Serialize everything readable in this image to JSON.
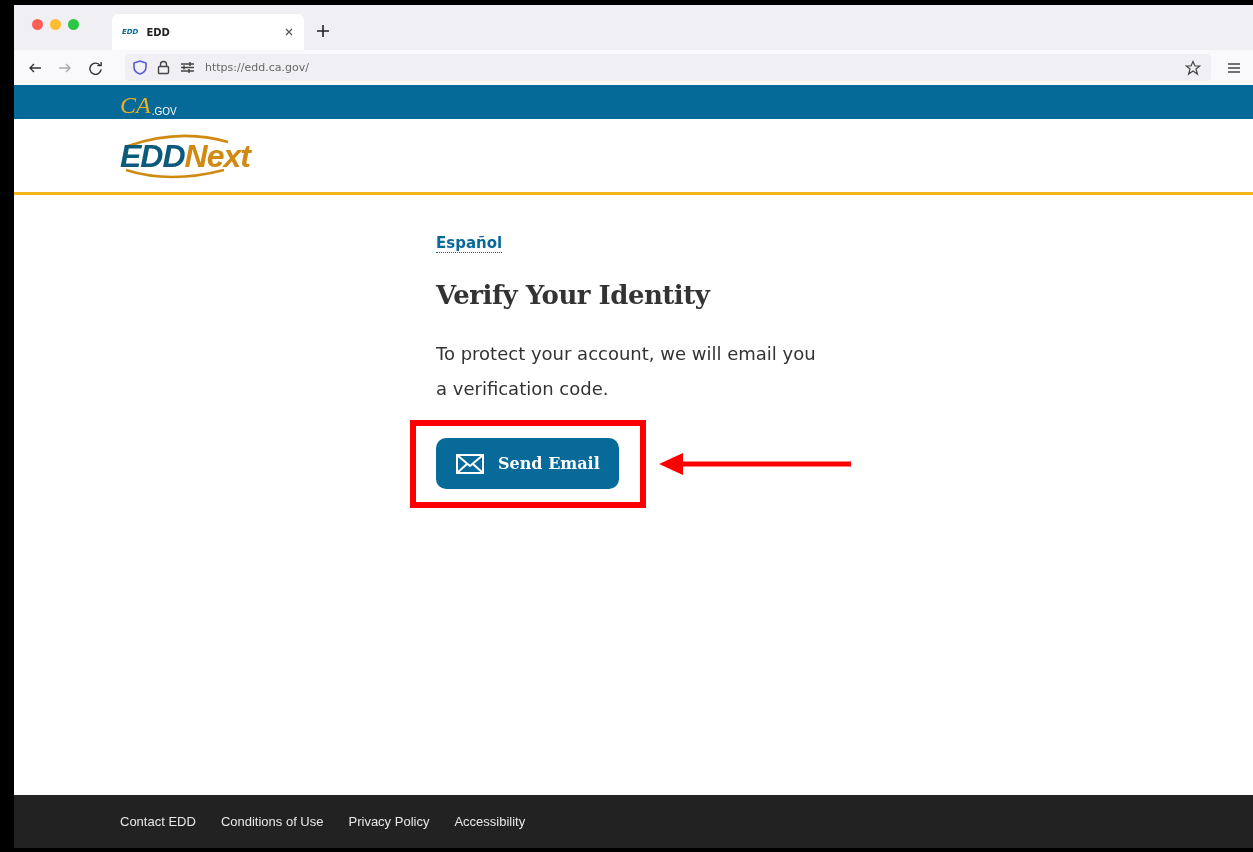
{
  "browser": {
    "tab": {
      "favicon": "EDD",
      "title": "EDD",
      "selected": true
    },
    "url": "https://edd.ca.gov/"
  },
  "gov_bar": {
    "logo_mark": "CA",
    "logo_suffix": ".GOV"
  },
  "header": {
    "logo_part_1": "EDD",
    "logo_part_2": "Next"
  },
  "main": {
    "language_link": "Español",
    "heading": "Verify Your Identity",
    "message": "To protect your account, we will email you a verification code.",
    "button": "Send Email",
    "highlighted": true
  },
  "footer": {
    "links": [
      "Contact EDD",
      "Conditions of Use",
      "Privacy Policy",
      "Accessibility"
    ]
  }
}
